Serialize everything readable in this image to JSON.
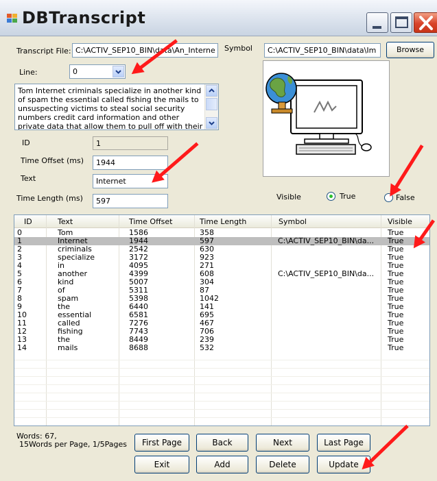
{
  "window": {
    "title": "DBTranscript"
  },
  "form": {
    "transcript_file_label": "Transcript File:",
    "transcript_file_value": "C:\\ACTIV_SEP10_BIN\\data\\An_Interne",
    "symbol_label": "Symbol",
    "symbol_value": "C:\\ACTIV_SEP10_BIN\\data\\Im",
    "browse_label": "Browse",
    "line_label": "Line:",
    "line_value": "0",
    "transcript_text": "Tom Internet criminals specialize in another kind of spam the essential called fishing the mails to unsuspecting victims to steal social security numbers credit card information and other private data that allow them to pull off with their victims",
    "id_label": "ID",
    "id_value": "1",
    "time_offset_label": "Time Offset  (ms)",
    "time_offset_value": "1944",
    "text_label": "Text",
    "text_value": "Internet",
    "time_length_label": "Time Length  (ms)",
    "time_length_value": "597",
    "visible_label": "Visible",
    "visible_true_label": "True",
    "visible_false_label": "False",
    "visible_selected": "True"
  },
  "grid": {
    "columns": [
      "ID",
      "Text",
      "Time Offset",
      "Time Length",
      "Symbol",
      "Visible"
    ],
    "selected_index": 1,
    "rows": [
      [
        "0",
        "Tom",
        "1586",
        "358",
        "",
        "True"
      ],
      [
        "1",
        "Internet",
        "1944",
        "597",
        "C:\\ACTIV_SEP10_BIN\\da...",
        "True"
      ],
      [
        "2",
        "criminals",
        "2542",
        "630",
        "",
        "True"
      ],
      [
        "3",
        "specialize",
        "3172",
        "923",
        "",
        "True"
      ],
      [
        "4",
        "in",
        "4095",
        "271",
        "",
        "True"
      ],
      [
        "5",
        "another",
        "4399",
        "608",
        "C:\\ACTIV_SEP10_BIN\\da...",
        "True"
      ],
      [
        "6",
        "kind",
        "5007",
        "304",
        "",
        "True"
      ],
      [
        "7",
        "of",
        "5311",
        "87",
        "",
        "True"
      ],
      [
        "8",
        "spam",
        "5398",
        "1042",
        "",
        "True"
      ],
      [
        "9",
        "the",
        "6440",
        "141",
        "",
        "True"
      ],
      [
        "10",
        "essential",
        "6581",
        "695",
        "",
        "True"
      ],
      [
        "11",
        "called",
        "7276",
        "467",
        "",
        "True"
      ],
      [
        "12",
        "fishing",
        "7743",
        "706",
        "",
        "True"
      ],
      [
        "13",
        "the",
        "8449",
        "239",
        "",
        "True"
      ],
      [
        "14",
        "mails",
        "8688",
        "532",
        "",
        "True"
      ]
    ]
  },
  "footer": {
    "words_line1": "Words: 67,",
    "words_line2": "15Words per Page, 1/5Pages",
    "first_page": "First Page",
    "back": "Back",
    "next": "Next",
    "last_page": "Last Page",
    "exit": "Exit",
    "add": "Add",
    "delete": "Delete",
    "update": "Update"
  },
  "colors": {
    "annotation_arrow": "#ff1a1a",
    "selected_row": "#bebebe",
    "window_face": "#ece9d8"
  }
}
